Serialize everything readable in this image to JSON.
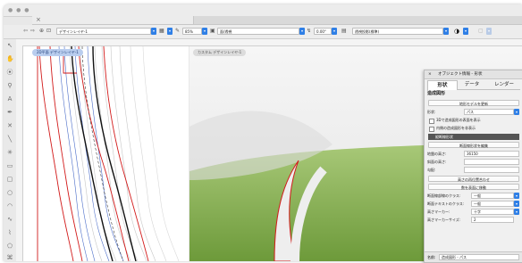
{
  "toolbar": {
    "layer_plane": "デザインレイヤ-1",
    "zoom": "85%",
    "view": "面/透視",
    "angle": "0.00°",
    "render_mode": "透視投影(標準)"
  },
  "views": {
    "left_label": "2D平面 デザインレイヤ-1",
    "right_label": "カスタム デザインレイヤ-1"
  },
  "panel": {
    "close": "×",
    "title": "オブジェクト情報 - 形状",
    "tabs": [
      "形状",
      "データ",
      "レンダー"
    ],
    "heading": "造成図形",
    "btn_update_terrain": "地形モデルを更新",
    "shape_label": "形状:",
    "shape_value": "パス",
    "chk_show_3d": "3Dで造成図形の表面を表示",
    "chk_hide_inner": "内側の造成図形を非表示",
    "section_title": "縦断線形状",
    "btn_edit_profile": "断面線形状を編集",
    "elev_label": "地盤の高さ:",
    "elev_value": "36150",
    "slope_label": "斜面の高さ:",
    "lock_label": "勾配:",
    "btn_align_height": "高さの再位置合わせ",
    "btn_move_surface": "数を表面に移動",
    "class_label": "断面線部線のクラス:",
    "class_value": "一般",
    "text_class_label": "断面テキストのクラス:",
    "text_class_value": "一般",
    "marker_label": "高さマーカー:",
    "marker_value": "十字",
    "extra_label": "高さマーカーサイズ:",
    "extra_value": "2",
    "status_name": "名前:",
    "status_value": "造成図形 - パス"
  },
  "tools": [
    "selection-tool",
    "pan-tool",
    "flyover-tool",
    "zoom-tool",
    "text-tool",
    "attribute-tool",
    "line-tool",
    "2d-locus-tool",
    "rectangle-tool",
    "rounded-rect-tool",
    "circle-tool",
    "arc-tool",
    "freehand-tool",
    "polyline-tool",
    "polygon-tool",
    "double-line-tool",
    "spiral-tool",
    "resize-tool",
    "eyedropper-tool"
  ]
}
